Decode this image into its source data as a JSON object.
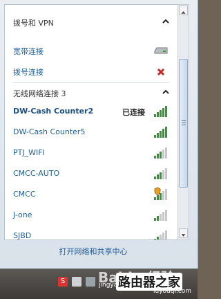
{
  "sections": {
    "dialup": {
      "title": "拨号和 VPN",
      "items": [
        {
          "label": "宽带连接",
          "icon": "modem-icon"
        },
        {
          "label": "拨号连接",
          "icon": "disconnect-x-icon"
        }
      ]
    },
    "wireless": {
      "title": "无线网络连接 3",
      "networks": [
        {
          "label": "DW-Cash Counter2",
          "status": "已连接",
          "signal": 5,
          "secured": false
        },
        {
          "label": "DW-Cash Counter5",
          "status": "",
          "signal": 5,
          "secured": false
        },
        {
          "label": "PTJ_WIFI",
          "status": "",
          "signal": 3,
          "secured": false
        },
        {
          "label": "CMCC-AUTO",
          "status": "",
          "signal": 3,
          "secured": false
        },
        {
          "label": "CMCC",
          "status": "",
          "signal": 3,
          "secured": true
        },
        {
          "label": "J-one",
          "status": "",
          "signal": 2,
          "secured": false
        },
        {
          "label": "SJBD",
          "status": "",
          "signal": 2,
          "secured": false
        }
      ]
    }
  },
  "footer": {
    "link": "打开网络和共享中心"
  },
  "watermark": {
    "brand": "Baidu 经验",
    "site": "jingyan.baidu.com",
    "router": "路由器之家",
    "router_url": "luyouqi.com"
  },
  "colors": {
    "link": "#1c5d99",
    "signal": "#2d9b2d",
    "danger": "#cc2222"
  }
}
